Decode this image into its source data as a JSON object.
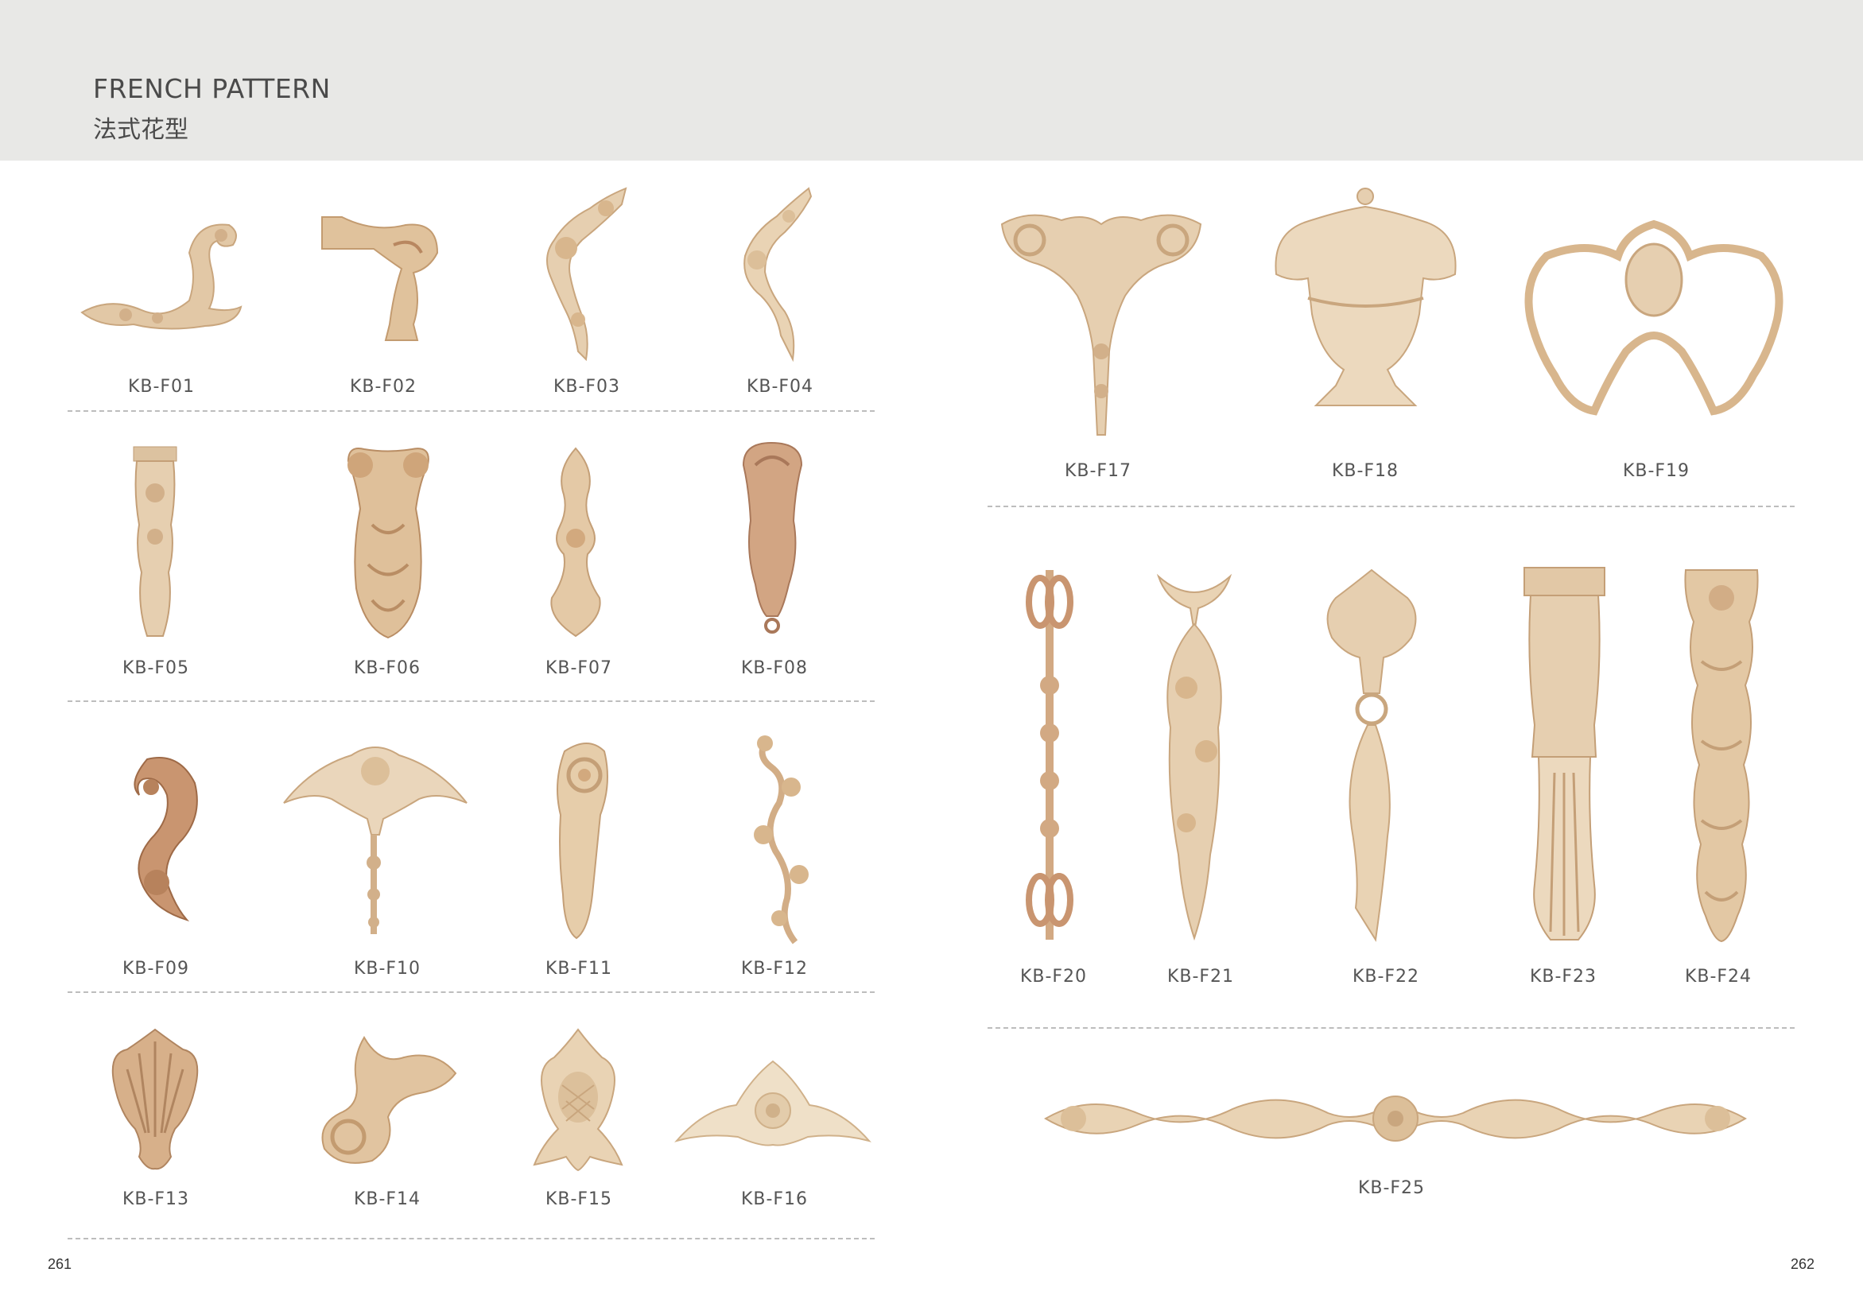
{
  "header": {
    "title_en": "FRENCH PATTERN",
    "title_cn": "法式花型"
  },
  "colors": {
    "wood_light": "#e9d3b4",
    "wood_mid": "#d8b68d",
    "wood_dark": "#b88760",
    "wood_reddish": "#c08463"
  },
  "products": [
    {
      "code": "KB-F01",
      "icon": "scroll-corner-ornament"
    },
    {
      "code": "KB-F02",
      "icon": "corner-bracket-ornament"
    },
    {
      "code": "KB-F03",
      "icon": "arc-scroll-ornament"
    },
    {
      "code": "KB-F04",
      "icon": "leaf-scroll-ornament"
    },
    {
      "code": "KB-F05",
      "icon": "column-drop-corbel"
    },
    {
      "code": "KB-F06",
      "icon": "acanthus-corbel"
    },
    {
      "code": "KB-F07",
      "icon": "fleur-drop-ornament"
    },
    {
      "code": "KB-F08",
      "icon": "shell-corbel"
    },
    {
      "code": "KB-F09",
      "icon": "c-scroll-acanthus"
    },
    {
      "code": "KB-F10",
      "icon": "pediment-garland-ornament"
    },
    {
      "code": "KB-F11",
      "icon": "volute-corbel"
    },
    {
      "code": "KB-F12",
      "icon": "vine-scroll-ornament"
    },
    {
      "code": "KB-F13",
      "icon": "fan-shell-onlay"
    },
    {
      "code": "KB-F14",
      "icon": "leaf-curl-onlay"
    },
    {
      "code": "KB-F15",
      "icon": "pineapple-onlay"
    },
    {
      "code": "KB-F16",
      "icon": "flower-crest-onlay"
    },
    {
      "code": "KB-F17",
      "icon": "symmetric-scroll-drop"
    },
    {
      "code": "KB-F18",
      "icon": "urn-crest-ornament"
    },
    {
      "code": "KB-F19",
      "icon": "cartouche-scroll-ornament"
    },
    {
      "code": "KB-F20",
      "icon": "ribbon-link-pendant"
    },
    {
      "code": "KB-F21",
      "icon": "bow-garland-drop"
    },
    {
      "code": "KB-F22",
      "icon": "tassel-crest-drop"
    },
    {
      "code": "KB-F23",
      "icon": "drapery-column"
    },
    {
      "code": "KB-F24",
      "icon": "bellflower-drop"
    },
    {
      "code": "KB-F25",
      "icon": "long-frieze-ornament"
    }
  ],
  "pages": {
    "left": "261",
    "right": "262"
  }
}
